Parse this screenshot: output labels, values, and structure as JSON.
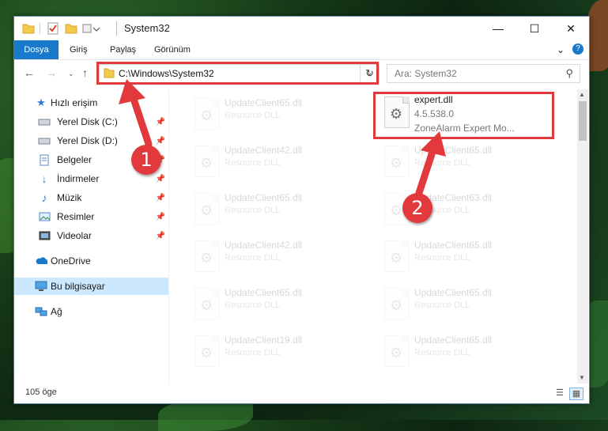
{
  "window": {
    "title": "System32"
  },
  "ribbon": {
    "tabs": [
      "Dosya",
      "Giriş",
      "Paylaş",
      "Görünüm"
    ]
  },
  "address": {
    "path": "C:\\Windows\\System32"
  },
  "search": {
    "placeholder": "Ara: System32"
  },
  "sidebar": {
    "quick_access": "Hızlı erişim",
    "items": [
      {
        "label": "Yerel Disk (C:)",
        "icon": "drive-icon",
        "pinned": true
      },
      {
        "label": "Yerel Disk (D:)",
        "icon": "drive-icon",
        "pinned": true
      },
      {
        "label": "Belgeler",
        "icon": "documents-icon",
        "pinned": true
      },
      {
        "label": "İndirmeler",
        "icon": "download-icon",
        "pinned": true
      },
      {
        "label": "Müzik",
        "icon": "music-icon",
        "pinned": true
      },
      {
        "label": "Resimler",
        "icon": "pictures-icon",
        "pinned": true
      },
      {
        "label": "Videolar",
        "icon": "videos-icon",
        "pinned": true
      }
    ],
    "onedrive": "OneDrive",
    "this_pc": "Bu bilgisayar",
    "network": "Ağ"
  },
  "files": {
    "left_column": [
      {
        "name": "UpdateClient65.dll",
        "desc": "Resource DLL"
      },
      {
        "name": "UpdateClient42.dll",
        "desc": "Resource DLL"
      },
      {
        "name": "UpdateClient65.dll",
        "desc": "Resource DLL"
      },
      {
        "name": "UpdateClient42.dll",
        "desc": "Resource DLL"
      },
      {
        "name": "UpdateClient65.dll",
        "desc": "Resource DLL"
      },
      {
        "name": "UpdateClient19.dll",
        "desc": "Resource DLL"
      }
    ],
    "highlighted": {
      "name": "expert.dll",
      "version": "4.5.538.0",
      "desc": "ZoneAlarm Expert Mo..."
    },
    "right_column": [
      {
        "name": "UpdateClient65.dll",
        "desc": "Resource DLL"
      },
      {
        "name": "UpdateClient63.dll",
        "desc": "Resource DLL"
      },
      {
        "name": "UpdateClient65.dll",
        "desc": "Resource DLL"
      },
      {
        "name": "UpdateClient65.dll",
        "desc": "Resource DLL"
      },
      {
        "name": "UpdateClient65.dll",
        "desc": "Resource DLL"
      }
    ]
  },
  "status": {
    "count": "105 öge"
  },
  "annotations": {
    "step1": "1",
    "step2": "2"
  },
  "colors": {
    "accent": "#1979ca",
    "annotation": "#e2393c",
    "selected": "#cce8ff"
  }
}
